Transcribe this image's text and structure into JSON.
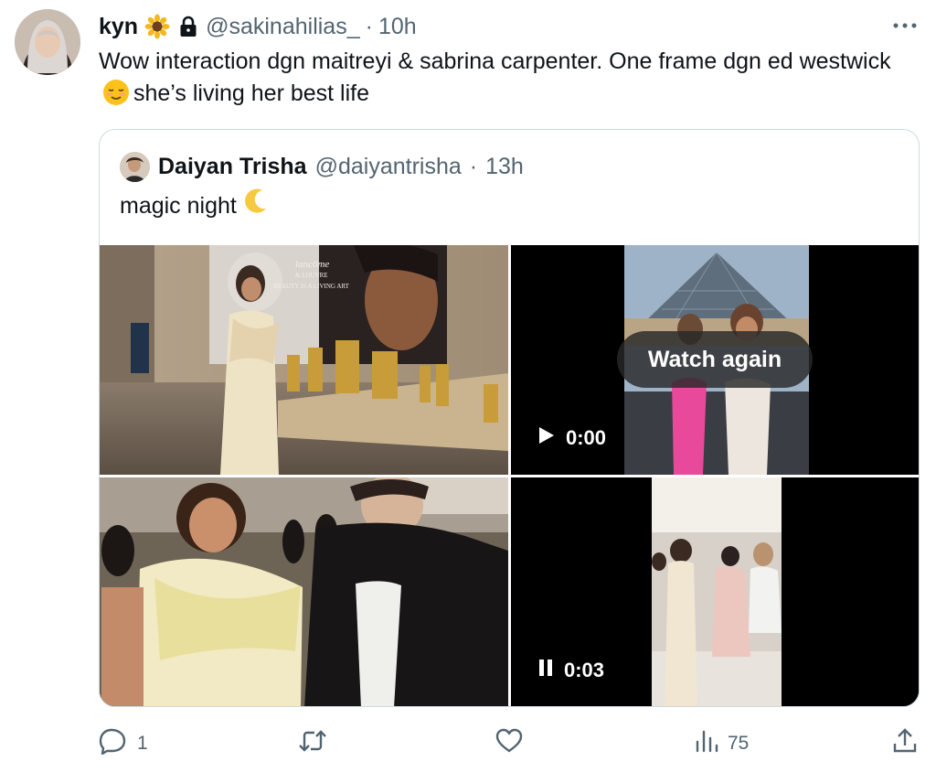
{
  "tweet": {
    "author_name": "kyn",
    "badge_emoji": "sunflower-emoji",
    "lock_icon": "lock-icon",
    "handle": "@sakinahilias_",
    "separator": "·",
    "time": "10h",
    "text_part1": "Wow interaction dgn maitreyi & sabrina carpenter. One frame dgn ed westwick",
    "text_emoji": "relieved-face-emoji",
    "text_part2": "she’s living her best life"
  },
  "quoted": {
    "author_name": "Daiyan Trisha",
    "handle": "@daiyantrisha",
    "separator": "·",
    "time": "13h",
    "text": "magic night",
    "text_emoji": "crescent-moon-emoji",
    "media": {
      "video1_overlay": "Watch again",
      "video1_time": "0:00",
      "video1_state": "play-icon",
      "video2_time": "0:03",
      "video2_state": "pause-icon",
      "poster_brand": "lancôme",
      "poster_sub": "& LOUVRE",
      "poster_tagline": "BEAUTY IS A LIVING ART"
    }
  },
  "actions": {
    "reply_count": "1",
    "retweet_count": "",
    "like_count": "",
    "views_count": "75"
  }
}
